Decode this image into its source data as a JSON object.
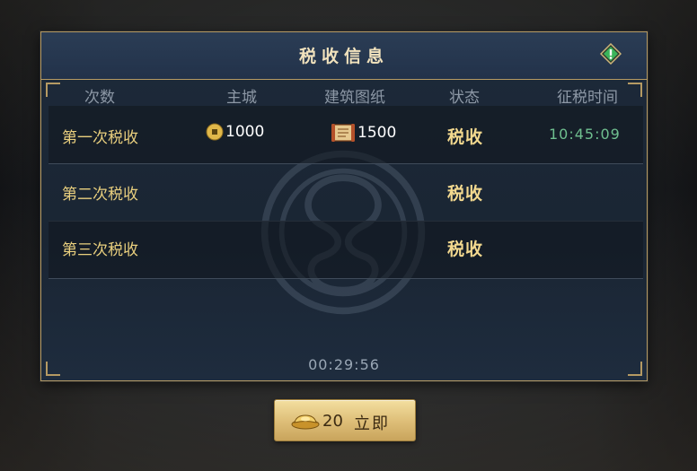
{
  "dialog": {
    "title": "税收信息"
  },
  "table": {
    "headers": [
      "次数",
      "主城",
      "建筑图纸",
      "状态",
      "征税时间"
    ],
    "rows": [
      {
        "label": "第一次税收",
        "gold": "1000",
        "blueprint": "1500",
        "status": "税收",
        "time": "10:45:09"
      },
      {
        "label": "第二次税收",
        "gold": "",
        "blueprint": "",
        "status": "税收",
        "time": ""
      },
      {
        "label": "第三次税收",
        "gold": "",
        "blueprint": "",
        "status": "税收",
        "time": ""
      }
    ]
  },
  "countdown": "00:29:56",
  "action_button": {
    "cost": "20",
    "label": "立即"
  },
  "colors": {
    "gold_text": "#e9cf7e",
    "time_green": "#6fbf8f",
    "panel_bg": "#1d2a3a",
    "border_gold": "#b59a63"
  },
  "icons": [
    "info-icon",
    "gold-coin-icon",
    "blueprint-scroll-icon",
    "gold-ingot-icon"
  ]
}
